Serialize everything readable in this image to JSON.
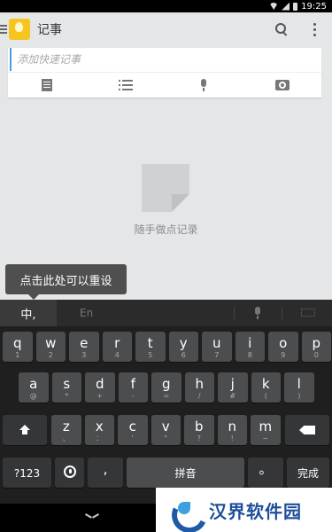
{
  "status_bar": {
    "time": "19:25"
  },
  "app": {
    "title": "记事"
  },
  "note_input": {
    "placeholder": "添加快速记事"
  },
  "note_tools": [
    "doc-icon",
    "list-icon",
    "mic-icon",
    "camera-icon"
  ],
  "empty_state": {
    "text": "随手做点记录"
  },
  "tooltip": {
    "text": "点击此处可以重设"
  },
  "keyboard": {
    "lang_zh": "中,",
    "lang_en": "En",
    "row1": [
      {
        "main": "q",
        "sub": "1"
      },
      {
        "main": "w",
        "sub": "2"
      },
      {
        "main": "e",
        "sub": "3"
      },
      {
        "main": "r",
        "sub": "4"
      },
      {
        "main": "t",
        "sub": "5"
      },
      {
        "main": "y",
        "sub": "6"
      },
      {
        "main": "u",
        "sub": "7"
      },
      {
        "main": "i",
        "sub": "8"
      },
      {
        "main": "o",
        "sub": "9"
      },
      {
        "main": "p",
        "sub": "0"
      }
    ],
    "row2": [
      {
        "main": "a",
        "sub": "@"
      },
      {
        "main": "s",
        "sub": "*"
      },
      {
        "main": "d",
        "sub": "+"
      },
      {
        "main": "f",
        "sub": "-"
      },
      {
        "main": "g",
        "sub": "="
      },
      {
        "main": "h",
        "sub": "/"
      },
      {
        "main": "j",
        "sub": "#"
      },
      {
        "main": "k",
        "sub": "("
      },
      {
        "main": "l",
        "sub": ")"
      }
    ],
    "row3": [
      {
        "main": "z",
        "sub": "、"
      },
      {
        "main": "x",
        "sub": "："
      },
      {
        "main": "c",
        "sub": "'"
      },
      {
        "main": "v",
        "sub": "\""
      },
      {
        "main": "b",
        "sub": "?"
      },
      {
        "main": "n",
        "sub": "!"
      },
      {
        "main": "m",
        "sub": "~"
      }
    ],
    "key_123": "?123",
    "key_comma": ",",
    "key_space": "拼音",
    "key_period": "。",
    "key_done": "完成"
  },
  "watermark": {
    "text": "汉界软件园"
  }
}
